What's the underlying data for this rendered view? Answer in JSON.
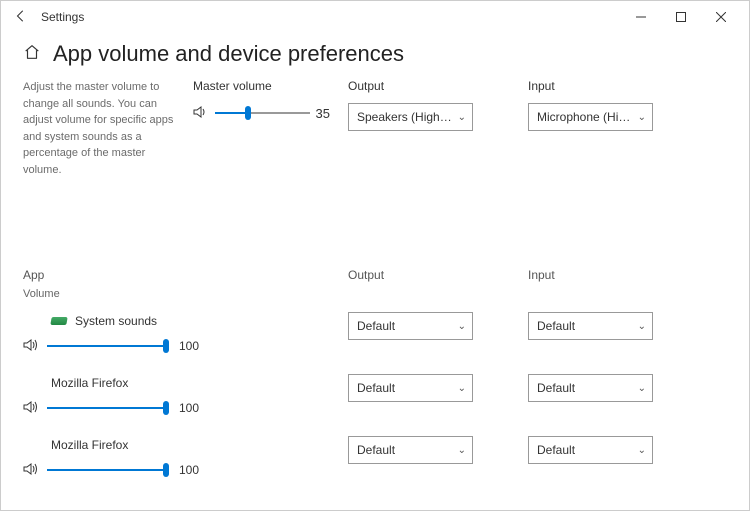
{
  "titlebar": {
    "title": "Settings"
  },
  "header": {
    "page_title": "App volume and device preferences"
  },
  "master": {
    "description": "Adjust the master volume to change all sounds. You can adjust volume for specific apps and system sounds as a percentage of the master volume.",
    "label": "Master volume",
    "value": "35",
    "percent": 35,
    "output_label": "Output",
    "input_label": "Input",
    "output_selected": "Speakers (High Defi…",
    "input_selected": "Microphone (High…"
  },
  "apps": {
    "app_header": "App",
    "volume_header": "Volume",
    "output_header": "Output",
    "input_header": "Input",
    "items": [
      {
        "name": "System sounds",
        "volume": "100",
        "percent": 100,
        "output": "Default",
        "input": "Default",
        "has_icon": true
      },
      {
        "name": "Mozilla Firefox",
        "volume": "100",
        "percent": 100,
        "output": "Default",
        "input": "Default",
        "has_icon": false
      },
      {
        "name": "Mozilla Firefox",
        "volume": "100",
        "percent": 100,
        "output": "Default",
        "input": "Default",
        "has_icon": false
      }
    ]
  }
}
